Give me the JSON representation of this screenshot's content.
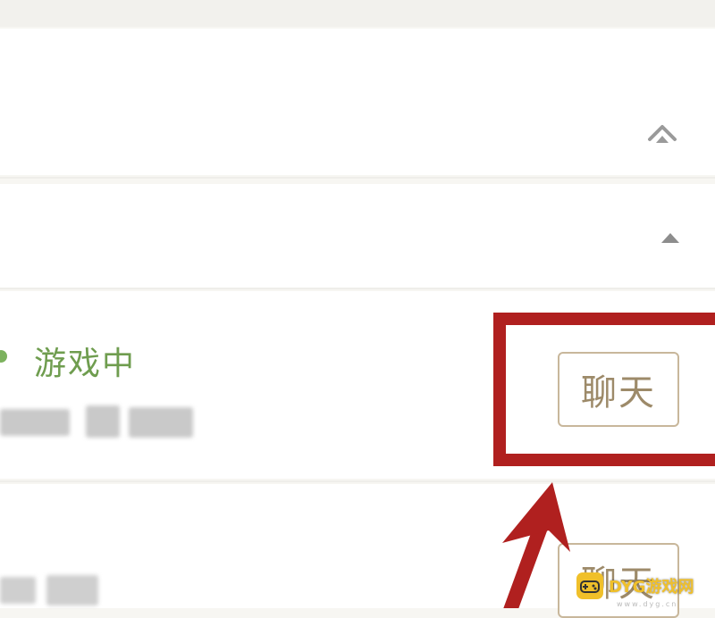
{
  "friends": [
    {
      "status": "游戏中",
      "button_label": "聊天"
    },
    {
      "button_label": "聊天"
    }
  ],
  "watermark": {
    "text": "DYG游戏网",
    "sub": "www.dyg.cn"
  },
  "colors": {
    "status_green": "#6f9d4f",
    "button_border": "#c8b79b",
    "button_text": "#9d8a69",
    "highlight_red": "#b0201f"
  },
  "icons": [
    "chevron-up-icon",
    "triangle-up-icon",
    "gamepad-icon"
  ]
}
